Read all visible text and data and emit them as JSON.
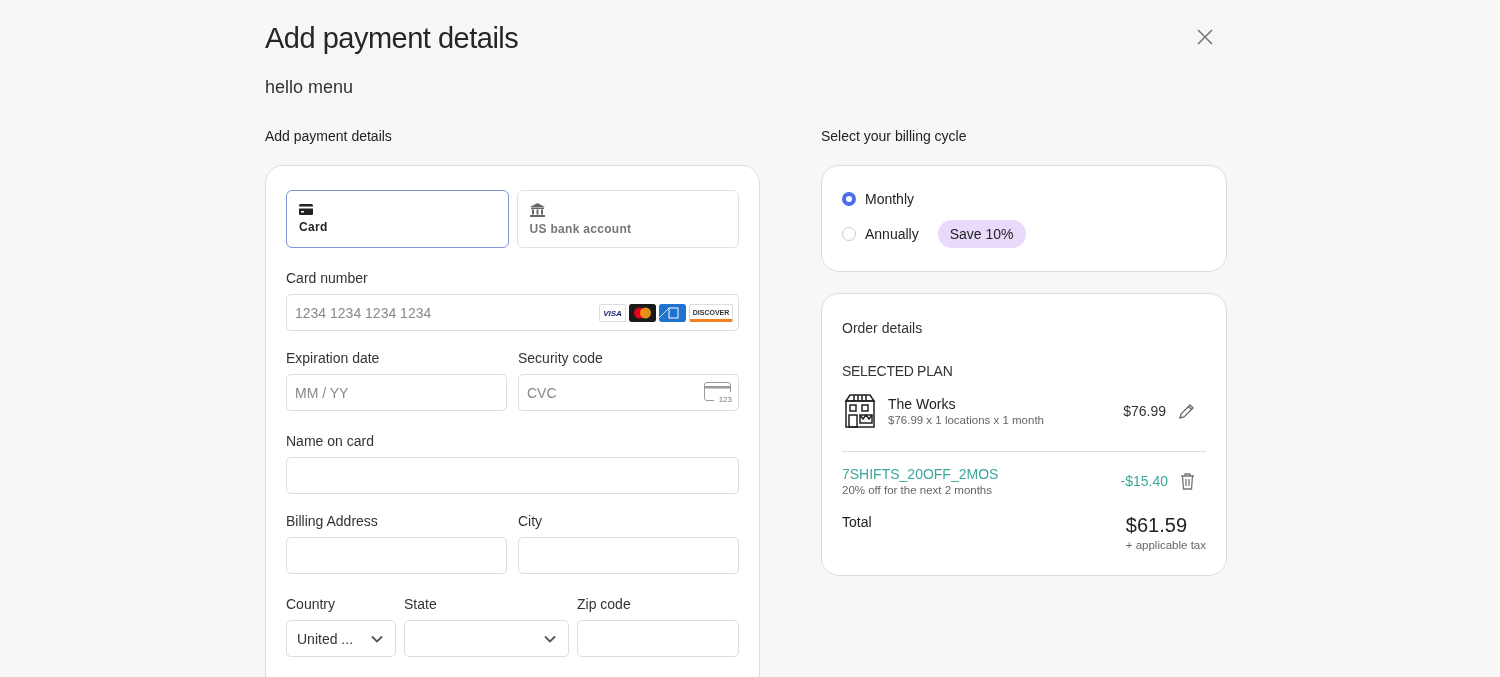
{
  "title": "Add payment details",
  "subtitle": "hello menu",
  "payment": {
    "heading": "Add payment details",
    "methods": [
      {
        "kind": "card",
        "label": "Card",
        "selected": true
      },
      {
        "kind": "bank",
        "label": "US bank account",
        "selected": false
      }
    ],
    "card_number": {
      "label": "Card number",
      "placeholder": "1234 1234 1234 1234",
      "brands": [
        {
          "kind": "visa",
          "label": "VISA"
        },
        {
          "kind": "mastercard"
        },
        {
          "kind": "amex"
        },
        {
          "kind": "discover",
          "label": "DISCOVER"
        }
      ]
    },
    "expiration": {
      "label": "Expiration date",
      "placeholder": "MM / YY"
    },
    "security": {
      "label": "Security code",
      "placeholder": "CVC",
      "icon_text": "123"
    },
    "name_on_card": {
      "label": "Name on card"
    },
    "billing_address": {
      "label": "Billing Address"
    },
    "city": {
      "label": "City"
    },
    "country": {
      "label": "Country",
      "value": "United ..."
    },
    "state": {
      "label": "State"
    },
    "zip": {
      "label": "Zip code"
    }
  },
  "billing": {
    "heading": "Select your billing cycle",
    "options": [
      {
        "label": "Monthly",
        "selected": true
      },
      {
        "label": "Annually",
        "selected": false,
        "badge": "Save 10%"
      }
    ]
  },
  "order": {
    "heading": "Order details",
    "plan_heading": "SELECTED PLAN",
    "plan": {
      "name": "The Works",
      "detail": "$76.99 x 1 locations x 1 month",
      "price": "$76.99"
    },
    "coupon": {
      "code": "7SHIFTS_20OFF_2MOS",
      "detail": "20% off for the next 2 months",
      "amount": "-$15.40"
    },
    "total": {
      "label": "Total",
      "amount": "$61.59",
      "note": "+ applicable tax"
    }
  }
}
